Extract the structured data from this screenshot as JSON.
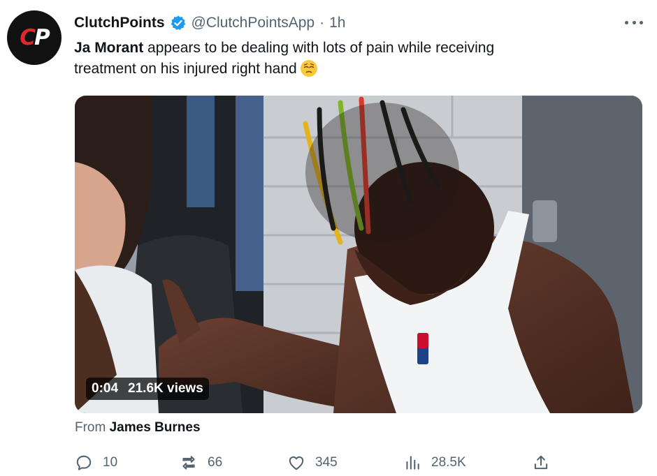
{
  "tweet": {
    "avatar_text_c": "C",
    "avatar_text_p": "P",
    "display_name": "ClutchPoints",
    "handle": "@ClutchPointsApp",
    "separator": "·",
    "time": "1h",
    "text_bold": "Ja Morant",
    "text_line1_rest": " appears to be dealing with lots of pain while receiving",
    "text_line2": "treatment on his injured right hand"
  },
  "media": {
    "duration": "0:04",
    "views": "21.6K views"
  },
  "attribution": {
    "prefix": "From ",
    "source": "James Burnes"
  },
  "actions": {
    "reply_count": "10",
    "retweet_count": "66",
    "like_count": "345",
    "views_count": "28.5K"
  },
  "icons": {
    "verified": "verified-badge-icon",
    "emoji": "relieved-face-emoji-icon",
    "more": "more-options-icon",
    "reply": "reply-icon",
    "retweet": "retweet-icon",
    "like": "heart-icon",
    "views": "views-bar-chart-icon",
    "share": "share-icon"
  },
  "colors": {
    "brand_red": "#e1262d",
    "verified_blue": "#1d9bf0",
    "muted": "#536471",
    "text": "#0f1419"
  }
}
